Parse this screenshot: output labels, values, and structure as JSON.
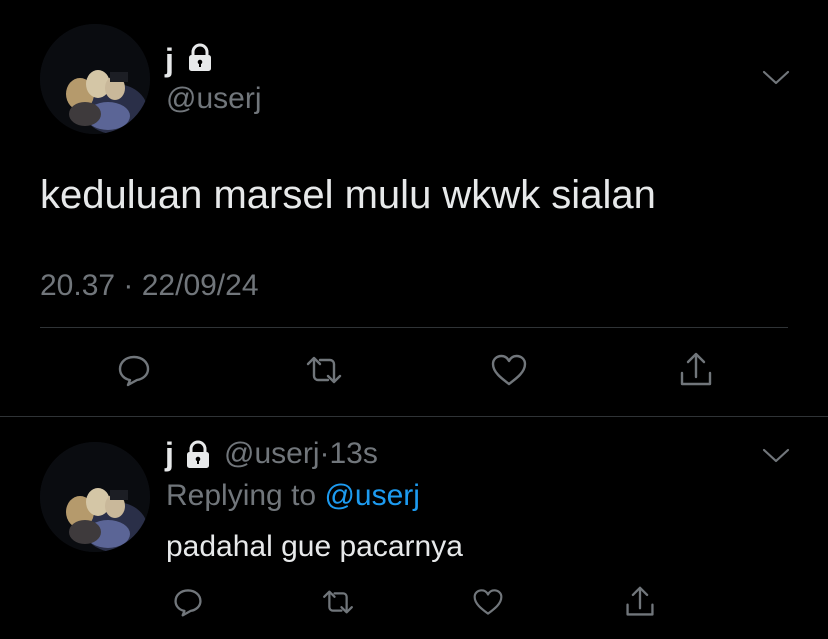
{
  "main_tweet": {
    "author_name": "j",
    "handle": "@userj",
    "text": "keduluan marsel mulu wkwk sialan",
    "timestamp": "20.37 · 22/09/24",
    "icons": {
      "lock": "lock-icon",
      "menu": "chevron-down-icon",
      "reply": "reply-icon",
      "retweet": "retweet-icon",
      "like": "heart-icon",
      "share": "share-icon"
    }
  },
  "reply_tweet": {
    "author_name": "j",
    "handle": "@userj",
    "separator": "·",
    "time_ago": "13s",
    "replying_prefix": "Replying to",
    "replying_to": "@userj",
    "text": "padahal gue pacarnya"
  },
  "colors": {
    "background": "#000000",
    "text_primary": "#e7e9ea",
    "text_secondary": "#71767b",
    "link": "#1d9bf0",
    "divider": "#2f3336"
  }
}
